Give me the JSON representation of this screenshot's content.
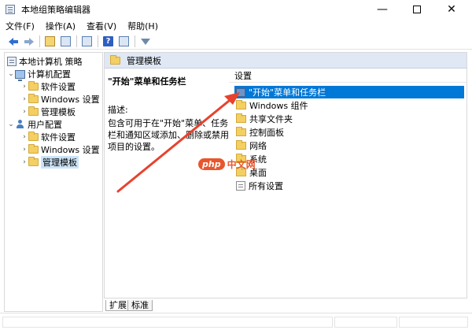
{
  "window": {
    "title": "本地组策略编辑器",
    "min_glyph": "—",
    "close_glyph": "✕"
  },
  "menu": [
    "文件(F)",
    "操作(A)",
    "查看(V)",
    "帮助(H)"
  ],
  "toolbar": {
    "back_icon": "back-arrow-icon",
    "forward_icon": "forward-arrow-icon",
    "help_glyph": "?"
  },
  "tree": {
    "root": "本地计算机 策略",
    "computer_config": "计算机配置",
    "computer_children": [
      "软件设置",
      "Windows 设置",
      "管理模板"
    ],
    "user_config": "用户配置",
    "user_children": [
      "软件设置",
      "Windows 设置",
      "管理模板"
    ],
    "selected": "管理模板"
  },
  "right_pane": {
    "header": "管理模板",
    "description_title": "\"开始\"菜单和任务栏",
    "description_label": "描述:",
    "description_body": "包含可用于在\"开始\"菜单、任务栏和通知区域添加、删除或禁用项目的设置。",
    "settings_column_header": "设置",
    "settings": [
      "\"开始\"菜单和任务栏",
      "Windows 组件",
      "共享文件夹",
      "控制面板",
      "网络",
      "系统",
      "桌面",
      "所有设置"
    ],
    "selected_setting": "\"开始\"菜单和任务栏"
  },
  "tabs": [
    "扩展",
    "标准"
  ],
  "annotation": {
    "arrow_color": "#e8422e"
  },
  "watermark": {
    "badge": "php",
    "text": "中文网"
  }
}
